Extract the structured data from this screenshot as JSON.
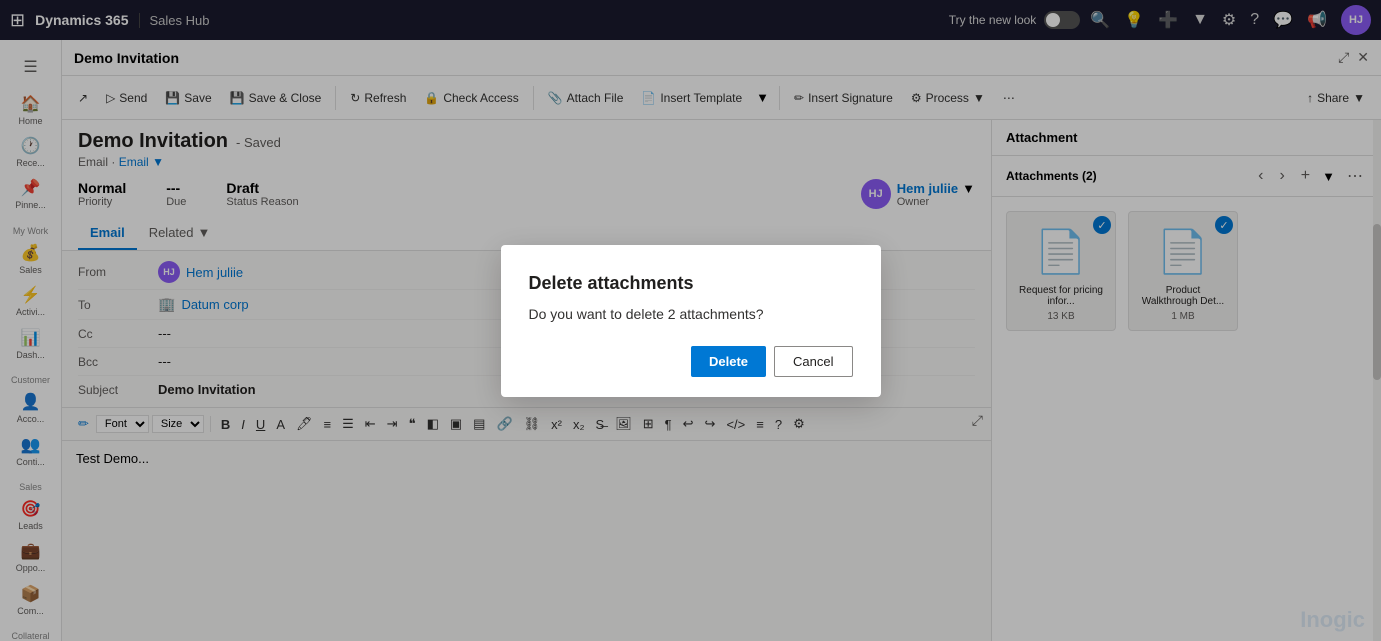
{
  "app": {
    "name": "Dynamics 365",
    "hub": "Sales Hub",
    "try_new_look": "Try the new look"
  },
  "panel": {
    "title": "Demo Invitation",
    "close_icon": "✕",
    "expand_icon": "⤢"
  },
  "toolbar": {
    "send": "Send",
    "save": "Save",
    "save_close": "Save & Close",
    "refresh": "Refresh",
    "check_access": "Check Access",
    "attach_file": "Attach File",
    "insert_template": "Insert Template",
    "insert_signature": "Insert Signature",
    "process": "Process",
    "share": "Share"
  },
  "form": {
    "title": "Demo Invitation",
    "saved_label": "- Saved",
    "type": "Email",
    "sub_type": "Email",
    "priority_label": "Priority",
    "priority_value": "Normal",
    "due_label": "Due",
    "due_value": "---",
    "status_label": "Status Reason",
    "status_value": "Draft",
    "owner_label": "Owner",
    "owner_name": "Hem juliie",
    "owner_initials": "HJ"
  },
  "tabs": {
    "email": "Email",
    "related": "Related"
  },
  "email_fields": {
    "from_label": "From",
    "from_value": "Hem juliie",
    "from_initials": "HJ",
    "to_label": "To",
    "to_value": "Datum corp",
    "cc_label": "Cc",
    "cc_value": "---",
    "bcc_label": "Bcc",
    "bcc_value": "---",
    "subject_label": "Subject",
    "subject_value": "Demo Invitation"
  },
  "editor": {
    "font_label": "Font",
    "size_label": "Size",
    "content": "Test Demo..."
  },
  "attachment_panel": {
    "title": "Attachment",
    "label": "Attachments (2)",
    "files": [
      {
        "name": "Request for pricing infor...",
        "size": "13 KB"
      },
      {
        "name": "Product Walkthrough Det...",
        "size": "1 MB"
      }
    ]
  },
  "dialog": {
    "title": "Delete attachments",
    "body": "Do you want to delete 2 attachments?",
    "delete_btn": "Delete",
    "cancel_btn": "Cancel"
  },
  "sidebar": {
    "items": [
      {
        "icon": "☰",
        "label": ""
      },
      {
        "icon": "🏠",
        "label": "Home"
      },
      {
        "icon": "🕐",
        "label": "Recent"
      },
      {
        "icon": "📌",
        "label": "Pinned"
      },
      {
        "icon": "📋",
        "label": "My Work"
      },
      {
        "icon": "💰",
        "label": "Sales"
      },
      {
        "icon": "⚡",
        "label": "Activities"
      },
      {
        "icon": "📊",
        "label": "Dash..."
      }
    ],
    "customer_section": "Customer",
    "customer_items": [
      {
        "icon": "👤",
        "label": "Acco..."
      },
      {
        "icon": "👥",
        "label": "Conti..."
      }
    ],
    "sales_section": "Sales",
    "sales_items": [
      {
        "icon": "🎯",
        "label": "Leads"
      },
      {
        "icon": "💼",
        "label": "Oppo..."
      },
      {
        "icon": "📦",
        "label": "Com..."
      }
    ],
    "collateral_section": "Collateral"
  },
  "watermark": "Inogic"
}
